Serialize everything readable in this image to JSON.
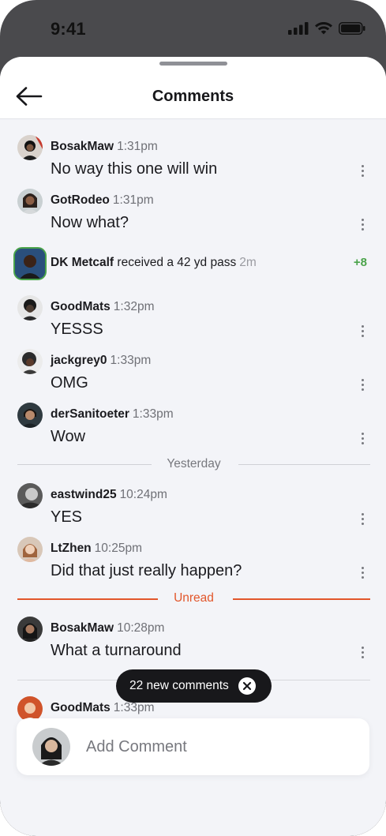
{
  "status_bar": {
    "time": "9:41"
  },
  "header": {
    "title": "Comments"
  },
  "feed": {
    "comments_a": [
      {
        "user": "BosakMaw",
        "time": "1:31pm",
        "text": "No way this one will win"
      },
      {
        "user": "GotRodeo",
        "time": "1:31pm",
        "text": "Now what?"
      }
    ],
    "event": {
      "player": "DK Metcalf",
      "action": "received a 42 yd pass",
      "ago": "2m",
      "points": "+8"
    },
    "comments_b": [
      {
        "user": "GoodMats",
        "time": "1:32pm",
        "text": "YESSS"
      },
      {
        "user": "jackgrey0",
        "time": "1:33pm",
        "text": "OMG"
      },
      {
        "user": "derSanitoeter",
        "time": "1:33pm",
        "text": "Wow"
      }
    ],
    "yesterday_label": "Yesterday",
    "comments_c": [
      {
        "user": "eastwind25",
        "time": "10:24pm",
        "text": "YES"
      },
      {
        "user": "LtZhen",
        "time": "10:25pm",
        "text": "Did that just really happen?"
      }
    ],
    "unread_label": "Unread",
    "comments_d": [
      {
        "user": "BosakMaw",
        "time": "10:28pm",
        "text": "What a turnaround"
      },
      {
        "user": "GoodMats",
        "time": "1:33pm",
        "text": ""
      }
    ]
  },
  "toast": {
    "label": "22 new comments"
  },
  "composer": {
    "placeholder": "Add Comment"
  },
  "colors": {
    "accent_unread": "#e2562b",
    "points_green": "#4aa34a",
    "sheet_bg": "#f3f4f8"
  }
}
